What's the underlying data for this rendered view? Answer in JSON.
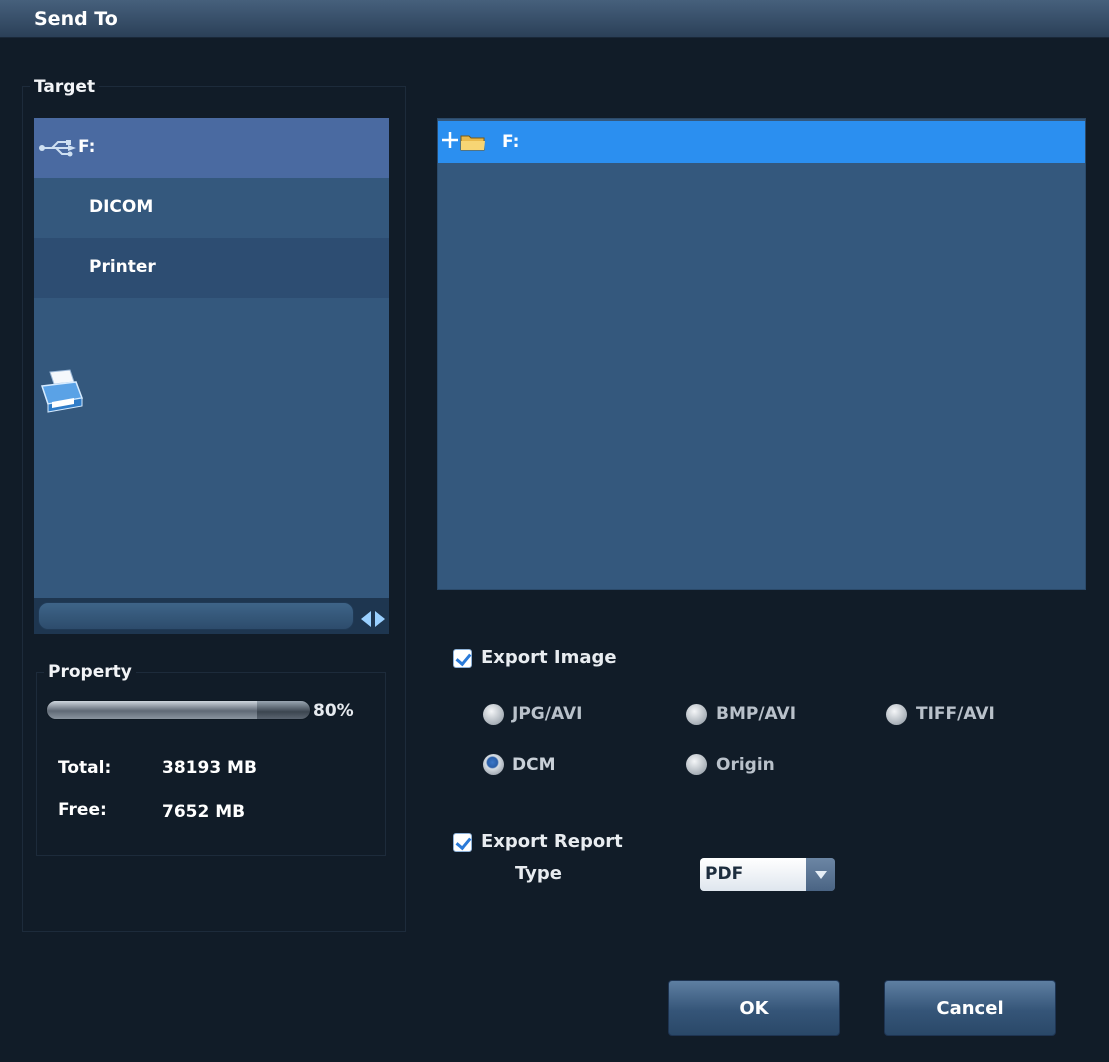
{
  "window": {
    "title": "Send To"
  },
  "target": {
    "group_label": "Target",
    "items": [
      {
        "label": "F:",
        "icon": "usb-drive-icon",
        "selected": true
      },
      {
        "label": "DICOM",
        "icon": "dicom-network-icon",
        "selected": false
      },
      {
        "label": "Printer",
        "icon": "printer-icon",
        "selected": false
      }
    ]
  },
  "tree": {
    "root": {
      "label": "F:",
      "icon": "folder-icon",
      "expander": "+"
    }
  },
  "property": {
    "group_label": "Property",
    "usage_percent": 80,
    "usage_text": "80%",
    "total_label": "Total:",
    "total_value": "38193 MB",
    "free_label": "Free:",
    "free_value": "7652 MB"
  },
  "export_image": {
    "label": "Export Image",
    "checked": true,
    "formats": [
      {
        "label": "JPG/AVI",
        "selected": false
      },
      {
        "label": "BMP/AVI",
        "selected": false
      },
      {
        "label": "TIFF/AVI",
        "selected": false
      },
      {
        "label": "DCM",
        "selected": true
      },
      {
        "label": "Origin",
        "selected": false
      }
    ]
  },
  "export_report": {
    "label": "Export Report",
    "checked": true,
    "type_label": "Type",
    "type_value": "PDF"
  },
  "buttons": {
    "ok": "OK",
    "cancel": "Cancel"
  },
  "colors": {
    "selection": "#2b8ff0",
    "panel": "#34587d",
    "background": "#111c28"
  }
}
